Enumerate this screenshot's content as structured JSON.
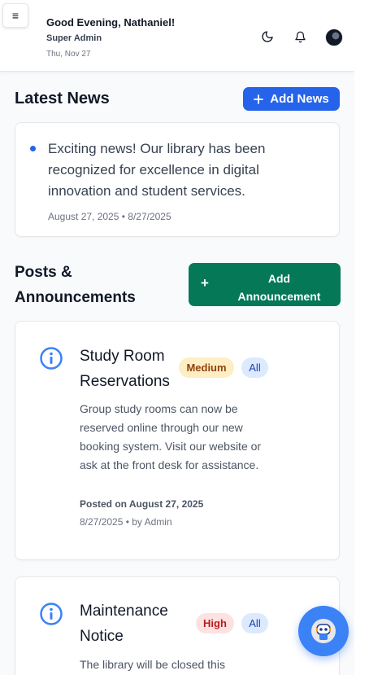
{
  "header": {
    "greeting": "Good Evening, Nathaniel!",
    "role": "Super Admin",
    "date": "Thu, Nov 27",
    "menu_icon": "≡",
    "icons": [
      "menu-icon",
      "moon-icon",
      "bell-icon",
      "avatar"
    ]
  },
  "latest_news": {
    "title": "Latest News",
    "add_button": "Add News",
    "items": [
      {
        "text": "Exciting news! Our library has been recognized for excellence in digital innovation and student services.",
        "meta": "August 27, 2025 • 8/27/2025"
      }
    ]
  },
  "posts": {
    "title": "Posts & Announcements",
    "title_line1": "Posts &",
    "title_line2": "Announcements",
    "add_button_line1": "Add",
    "add_button_line2": "Announcement",
    "items": [
      {
        "title_line1": "Study Room",
        "title_line2": "Reservations",
        "priority": "Medium",
        "audience": "All",
        "body": "Group study rooms can now be reserved online through our new booking system. Visit our website or ask at the front desk for assistance.",
        "posted": "Posted on August 27, 2025",
        "meta": "8/27/2025 • by Admin"
      },
      {
        "title_line1": "Maintenance",
        "title_line2": "Notice",
        "priority": "High",
        "audience": "All",
        "body": "The library will be closed this"
      }
    ]
  },
  "colors": {
    "primary_blue": "#2563eb",
    "announce_green": "#047857",
    "medium_badge": "#fdefc3",
    "high_badge": "#fee2e2",
    "all_badge": "#dbeafe"
  },
  "fab": {
    "icon": "assistant-robot-icon"
  }
}
